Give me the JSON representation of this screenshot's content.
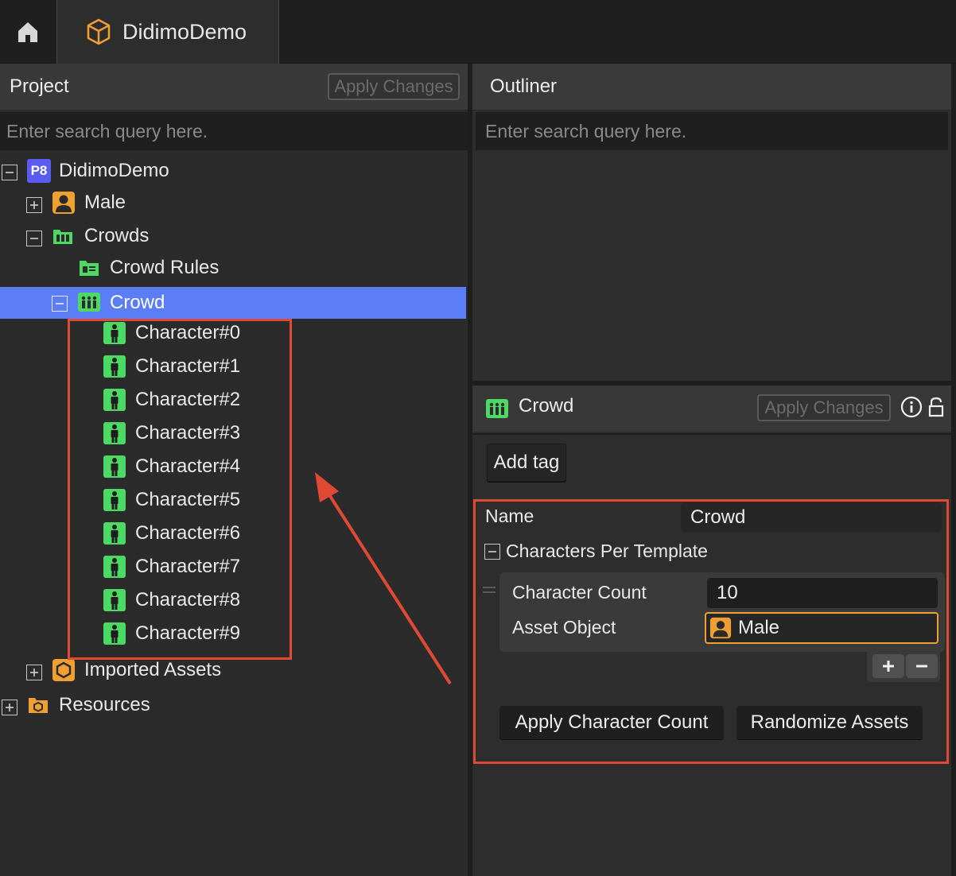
{
  "tab": {
    "title": "DidimoDemo",
    "icon": "cube-icon"
  },
  "home": {
    "icon": "home-icon"
  },
  "project": {
    "title": "Project",
    "apply_label": "Apply Changes",
    "search_placeholder": "Enter search query here.",
    "tree": {
      "root": "DidimoDemo",
      "root_badge": "P8",
      "male": "Male",
      "crowds": "Crowds",
      "crowd_rules": "Crowd Rules",
      "crowd": "Crowd",
      "characters": [
        "Character#0",
        "Character#1",
        "Character#2",
        "Character#3",
        "Character#4",
        "Character#5",
        "Character#6",
        "Character#7",
        "Character#8",
        "Character#9"
      ],
      "imported_assets": "Imported Assets",
      "resources": "Resources"
    }
  },
  "outliner": {
    "title": "Outliner",
    "search_placeholder": "Enter search query here."
  },
  "inspector": {
    "title": "Crowd",
    "apply_label": "Apply Changes",
    "add_tag": "Add tag",
    "name_label": "Name",
    "name_value": "Crowd",
    "section_label": "Characters Per Template",
    "character_count_label": "Character Count",
    "character_count_value": "10",
    "asset_object_label": "Asset Object",
    "asset_object_value": "Male",
    "apply_character_count": "Apply Character Count",
    "randomize_assets": "Randomize Assets",
    "add_symbol": "+",
    "remove_symbol": "−"
  },
  "colors": {
    "selection": "#5b7df5",
    "annotation": "#e04a35",
    "accent_orange": "#f0a030",
    "accent_green": "#4cd964"
  }
}
